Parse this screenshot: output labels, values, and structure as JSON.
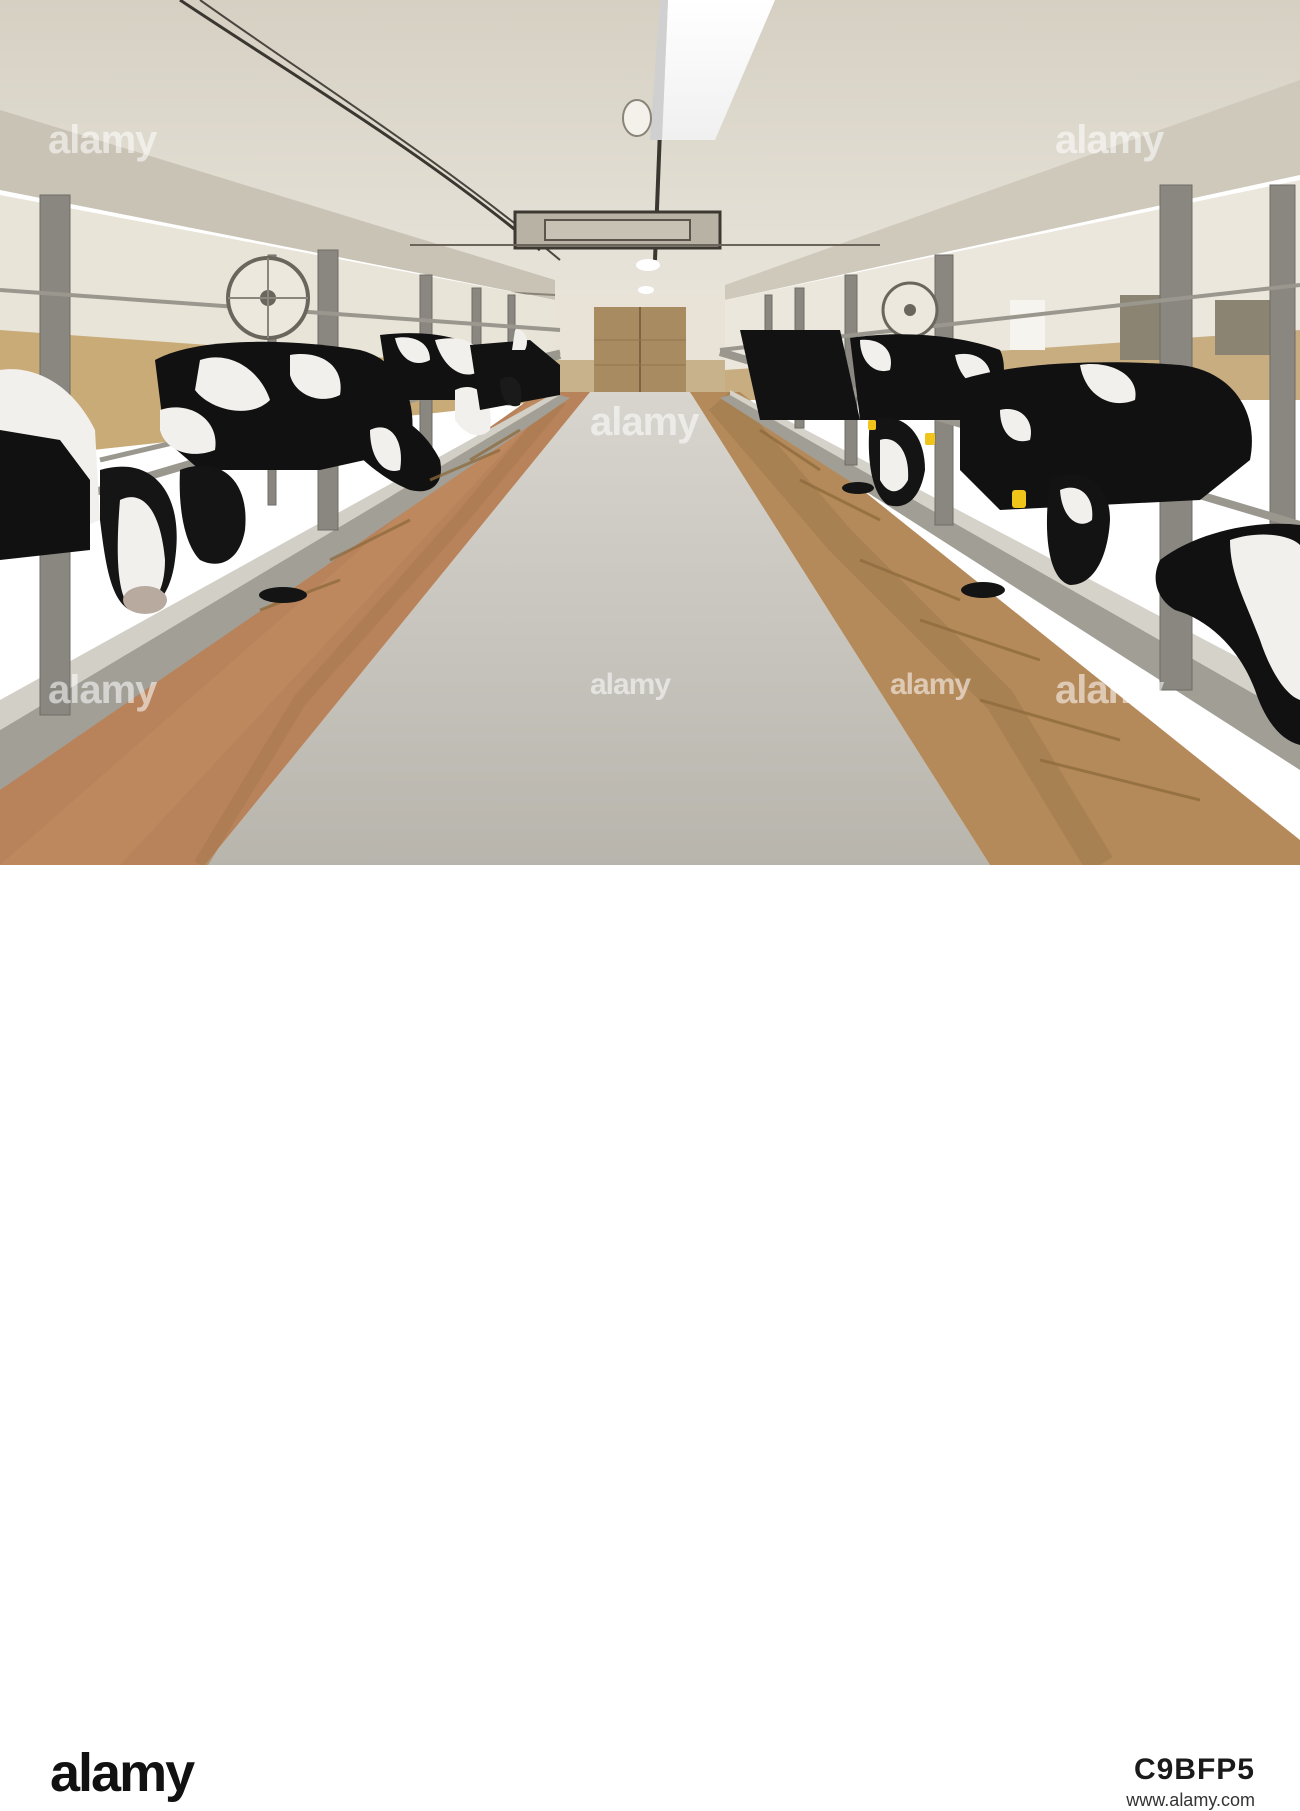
{
  "watermark": {
    "text": "alamy",
    "colors": {
      "ink": "#ffffff"
    }
  },
  "footer": {
    "logo_text": "alamy",
    "image_id": "C9BFP5",
    "url": "www.alamy.com"
  },
  "scene": {
    "subject": "dairy-barn-aisle-with-holstein-cows-in-stanchions",
    "colors": {
      "ceiling": "#d9d3c6",
      "floor": "#c3c0b8",
      "feed": "#a9814d",
      "cow_black": "#111111",
      "cow_white": "#f2f0ec",
      "door": "#a98b62"
    }
  }
}
